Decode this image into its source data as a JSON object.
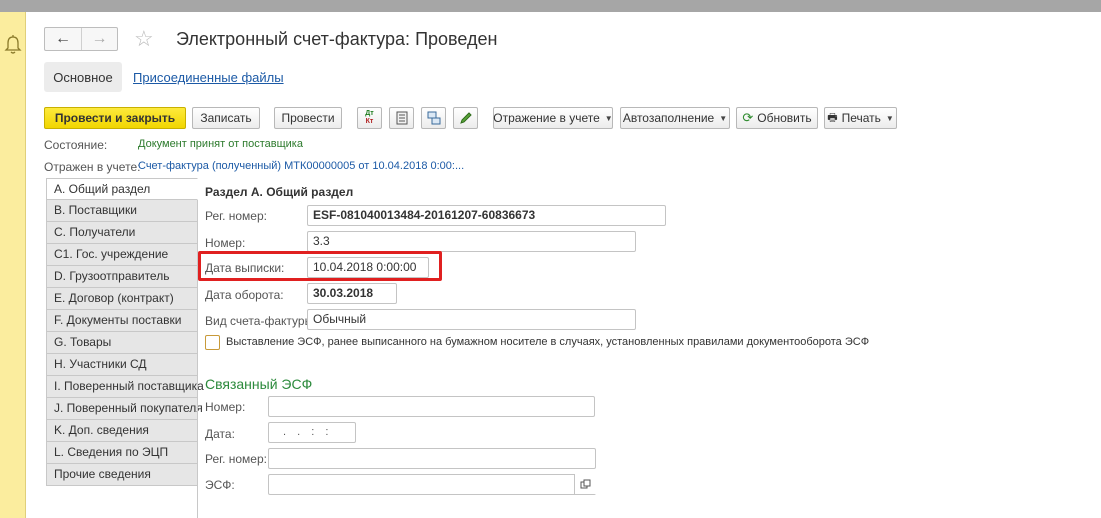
{
  "window": {
    "title": "Электронный счет-фактура: Проведен"
  },
  "nav": {
    "back_icon": "←",
    "forward_icon": "→",
    "star_icon": "☆"
  },
  "tabs": {
    "main": "Основное",
    "files": "Присоединенные файлы"
  },
  "toolbar": {
    "post_close": "Провести и закрыть",
    "save": "Записать",
    "post": "Провести",
    "dtkt_top": "Дт",
    "dtkt_bottom": "Кт",
    "reflection": "Отражение в учете",
    "autofill": "Автозаполнение",
    "refresh": "Обновить",
    "print": "Печать"
  },
  "status": {
    "state_label": "Состояние:",
    "state_value": "Документ принят от поставщика",
    "reflected_label": "Отражен в учете:",
    "reflected_value": "Счет-фактура (полученный) МТК00000005 от 10.04.2018 0:00:..."
  },
  "sections": [
    "A. Общий раздел",
    "B. Поставщики",
    "C. Получатели",
    "C1. Гос. учреждение",
    "D. Грузоотправитель",
    "E. Договор (контракт)",
    "F. Документы поставки",
    "G. Товары",
    "H. Участники СД",
    "I. Поверенный поставщика",
    "J. Поверенный покупателя",
    "K. Доп. сведения",
    "L. Сведения по ЭЦП",
    "Прочие сведения"
  ],
  "form": {
    "section_title": "Раздел А. Общий раздел",
    "reg_number_label": "Рег. номер:",
    "reg_number_value": "ESF-081040013484-20161207-60836673",
    "number_label": "Номер:",
    "number_value": "3.3",
    "issue_date_label": "Дата выписки:",
    "issue_date_value": "10.04.2018  0:00:00",
    "turnover_date_label": "Дата оборота:",
    "turnover_date_value": "30.03.2018",
    "invoice_type_label": "Вид счета-фактуры:",
    "invoice_type_value": "Обычный",
    "paper_checkbox_label": "Выставление ЭСФ, ранее выписанного на бумажном носителе в случаях, установленных правилами документооборота ЭСФ"
  },
  "linked": {
    "title": "Связанный ЭСФ",
    "number_label": "Номер:",
    "date_label": "Дата:",
    "date_mask": ". .   : :",
    "reg_number_label": "Рег. номер:",
    "esf_label": "ЭСФ:"
  }
}
